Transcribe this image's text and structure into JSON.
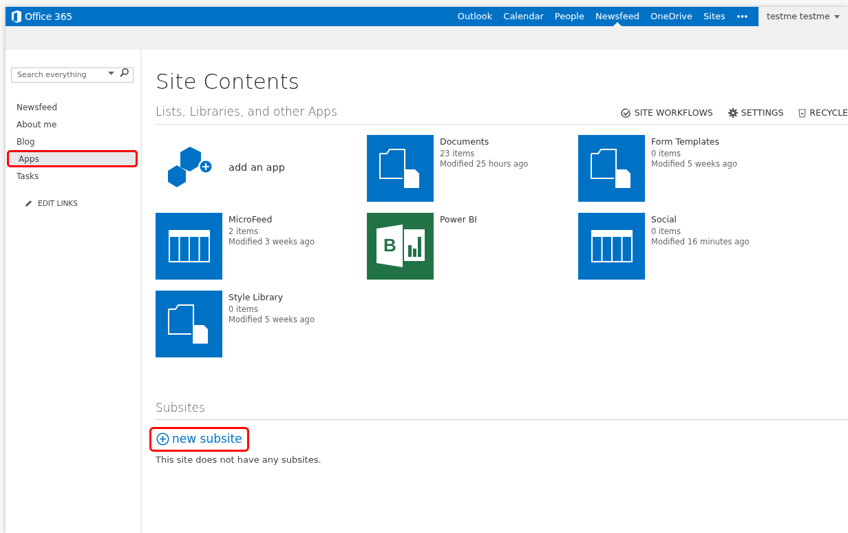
{
  "suite_bar": {
    "brand": "Office 365",
    "links": [
      {
        "label": "Outlook",
        "selected": false
      },
      {
        "label": "Calendar",
        "selected": false
      },
      {
        "label": "People",
        "selected": false
      },
      {
        "label": "Newsfeed",
        "selected": true
      },
      {
        "label": "OneDrive",
        "selected": false
      },
      {
        "label": "Sites",
        "selected": false
      }
    ],
    "more": "•••",
    "user": "testme testme"
  },
  "sidebar": {
    "search": {
      "placeholder": "Search everything"
    },
    "items": [
      {
        "label": "Newsfeed",
        "selected": false,
        "highlighted": false
      },
      {
        "label": "About me",
        "selected": false,
        "highlighted": false
      },
      {
        "label": "Blog",
        "selected": false,
        "highlighted": false
      },
      {
        "label": "Apps",
        "selected": true,
        "highlighted": true
      },
      {
        "label": "Tasks",
        "selected": false,
        "highlighted": false
      }
    ],
    "edit_links": "EDIT LINKS"
  },
  "page_title": "Site Contents",
  "lists_section": {
    "heading": "Lists, Libraries, and other Apps",
    "actions": [
      {
        "kind": "workflows",
        "label": "SITE WORKFLOWS"
      },
      {
        "kind": "settings",
        "label": "SETTINGS"
      },
      {
        "kind": "recycle",
        "label": "RECYCLE"
      }
    ],
    "tiles": [
      {
        "kind": "add",
        "title": "add an app"
      },
      {
        "kind": "folder",
        "title": "Documents",
        "count": "23 items",
        "modified": "Modified 25 hours ago"
      },
      {
        "kind": "folder",
        "title": "Form Templates",
        "count": "0 items",
        "modified": "Modified 5 weeks ago"
      },
      {
        "kind": "list",
        "title": "MicroFeed",
        "count": "2 items",
        "modified": "Modified 3 weeks ago"
      },
      {
        "kind": "powerbi",
        "title": "Power BI",
        "letter": "B"
      },
      {
        "kind": "list",
        "title": "Social",
        "count": "0 items",
        "modified": "Modified 16 minutes ago"
      },
      {
        "kind": "folder",
        "title": "Style Library",
        "count": "0 items",
        "modified": "Modified 5 weeks ago"
      }
    ]
  },
  "subsites_section": {
    "heading": "Subsites",
    "new_link": {
      "label": "new subsite",
      "highlighted": true
    },
    "empty_text": "This site does not have any subsites."
  }
}
